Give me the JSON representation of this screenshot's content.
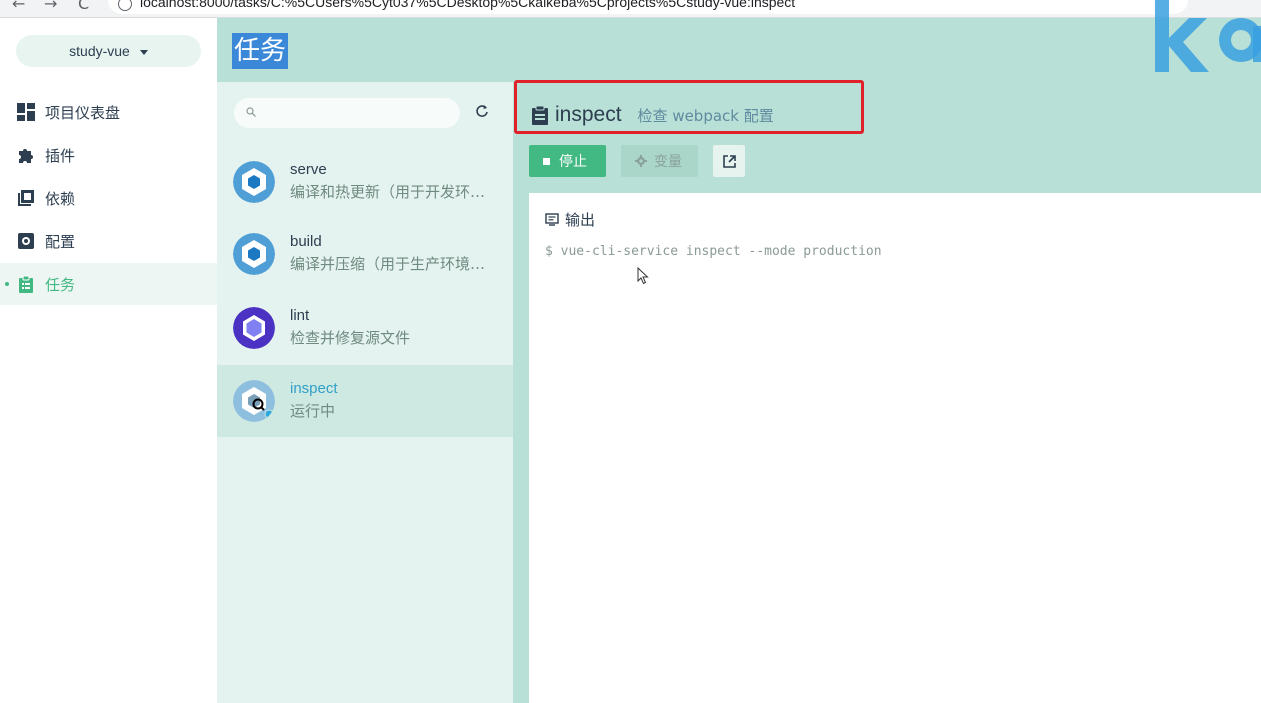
{
  "browser": {
    "back": "←",
    "forward": "→",
    "reload": "C",
    "url": "localhost:8000/tasks/C:%5CUsers%5Cyt037%5CDesktop%5Ckaikeba%5Cprojects%5Cstudy-vue:inspect"
  },
  "project": {
    "name": "study-vue"
  },
  "nav": [
    {
      "label": "项目仪表盘",
      "icon": "dashboard-icon"
    },
    {
      "label": "插件",
      "icon": "puzzle-icon"
    },
    {
      "label": "依赖",
      "icon": "library-icon"
    },
    {
      "label": "配置",
      "icon": "settings-box-icon"
    },
    {
      "label": "任务",
      "icon": "clipboard-list-icon",
      "active": true
    }
  ],
  "header": {
    "title": "任务"
  },
  "tasks": {
    "search_placeholder": "",
    "items": [
      {
        "name": "serve",
        "desc": "编译和热更新（用于开发环…",
        "icon": "webpack-icon"
      },
      {
        "name": "build",
        "desc": "编译并压缩（用于生产环境…",
        "icon": "webpack-icon"
      },
      {
        "name": "lint",
        "desc": "检查并修复源文件",
        "icon": "eslint-icon"
      },
      {
        "name": "inspect",
        "desc": "运行中",
        "icon": "webpack-inspect-icon",
        "selected": true
      }
    ]
  },
  "details": {
    "title": "inspect",
    "subtitle": "检查 webpack 配置",
    "stop_label": "停止",
    "vars_label": "变量",
    "output_label": "输出",
    "console": "$ vue-cli-service inspect --mode production"
  },
  "colors": {
    "accent": "#42b983",
    "header_bg": "#b8e0d6",
    "highlight": "#e0202a"
  }
}
